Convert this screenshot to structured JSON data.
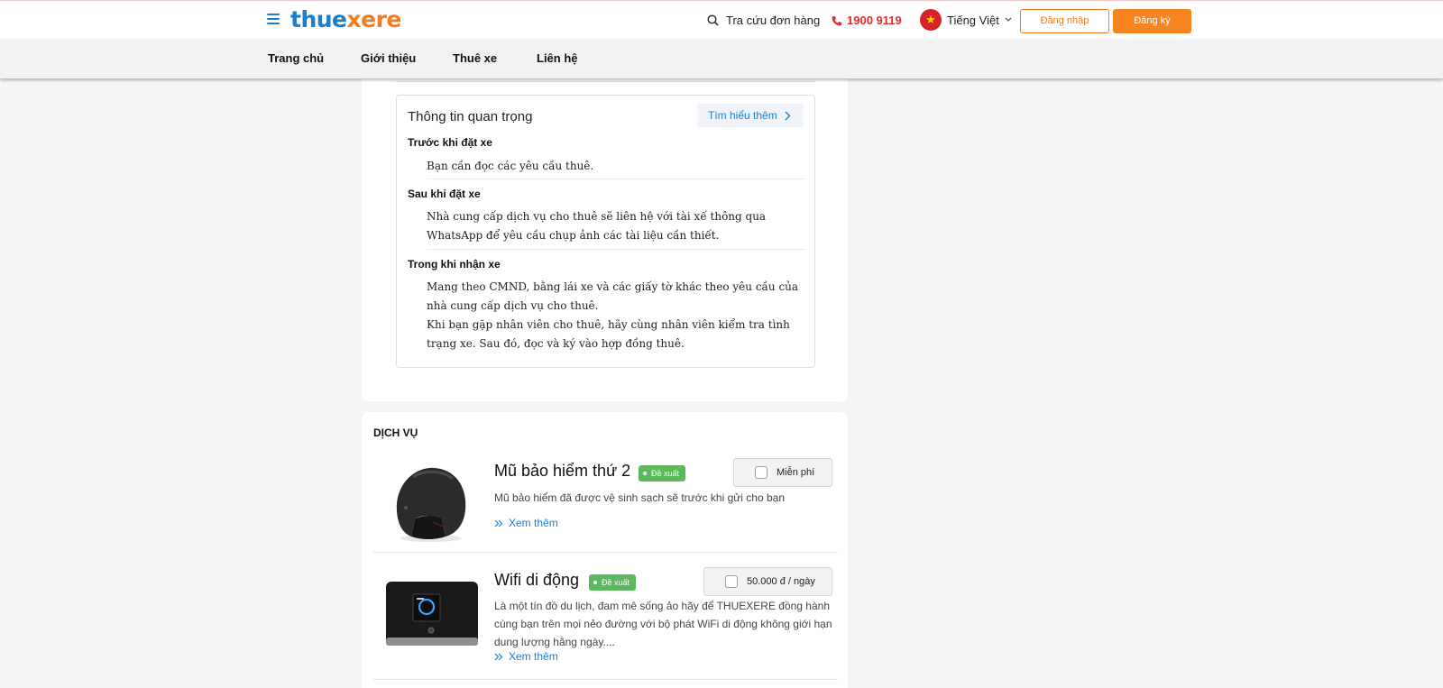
{
  "header": {
    "logo_part1": "thue",
    "logo_part2": "xere",
    "lookup_label": "Tra cứu đơn hàng",
    "phone": "1900 9119",
    "language": "Tiếng Việt",
    "login_label": "Đăng nhập",
    "register_label": "Đăng ký"
  },
  "nav": {
    "items": [
      "Trang chủ",
      "Giới thiệu",
      "Thuê xe",
      "Liên hệ"
    ]
  },
  "info": {
    "title": "Thông tin quan trọng",
    "learn_more": "Tìm hiểu thêm",
    "sections": [
      {
        "heading": "Trước khi đặt xe",
        "text": "Bạn cần đọc các yêu cầu thuê."
      },
      {
        "heading": "Sau khi đặt xe",
        "text": "Nhà cung cấp dịch vụ cho thuê sẽ liên hệ với tài xế thông qua WhatsApp để yêu cầu chụp ảnh các tài liệu cần thiết."
      },
      {
        "heading": "Trong khi nhận xe",
        "text1": "Mang theo CMND, bằng lái xe và các giấy tờ khác theo yêu cầu của nhà cung cấp dịch vụ cho thuê.",
        "text2": "Khi bạn gặp nhân viên cho thuê, hãy cùng nhân viên kiểm tra tình trạng xe. Sau đó, đọc và ký vào hợp đồng thuê."
      }
    ]
  },
  "services": {
    "title": "DỊCH VỤ",
    "items": [
      {
        "name": "Mũ bảo hiểm thứ 2",
        "badge": "Đề xuất",
        "price": "Miễn phí",
        "desc": "Mũ bảo hiểm đã được vệ sinh sạch sẽ trước khi gửi cho bạn",
        "see_more": "Xem thêm"
      },
      {
        "name": "Wifi di động",
        "badge": "Đề xuất",
        "price": "50.000 đ / ngày",
        "desc": "Là một tín đồ du lịch, đam mê sống ảo hãy để THUEXERE đồng hành cùng bạn trên mọi nẻo đường với bộ phát  WiFi di động không giới hạn dung lượng hằng ngày....",
        "see_more": "Xem thêm"
      }
    ]
  },
  "colors": {
    "brand_blue": "#1b7fd1",
    "brand_orange": "#f47b20",
    "phone_red": "#e52b2b",
    "badge_green": "#5cb85c"
  }
}
